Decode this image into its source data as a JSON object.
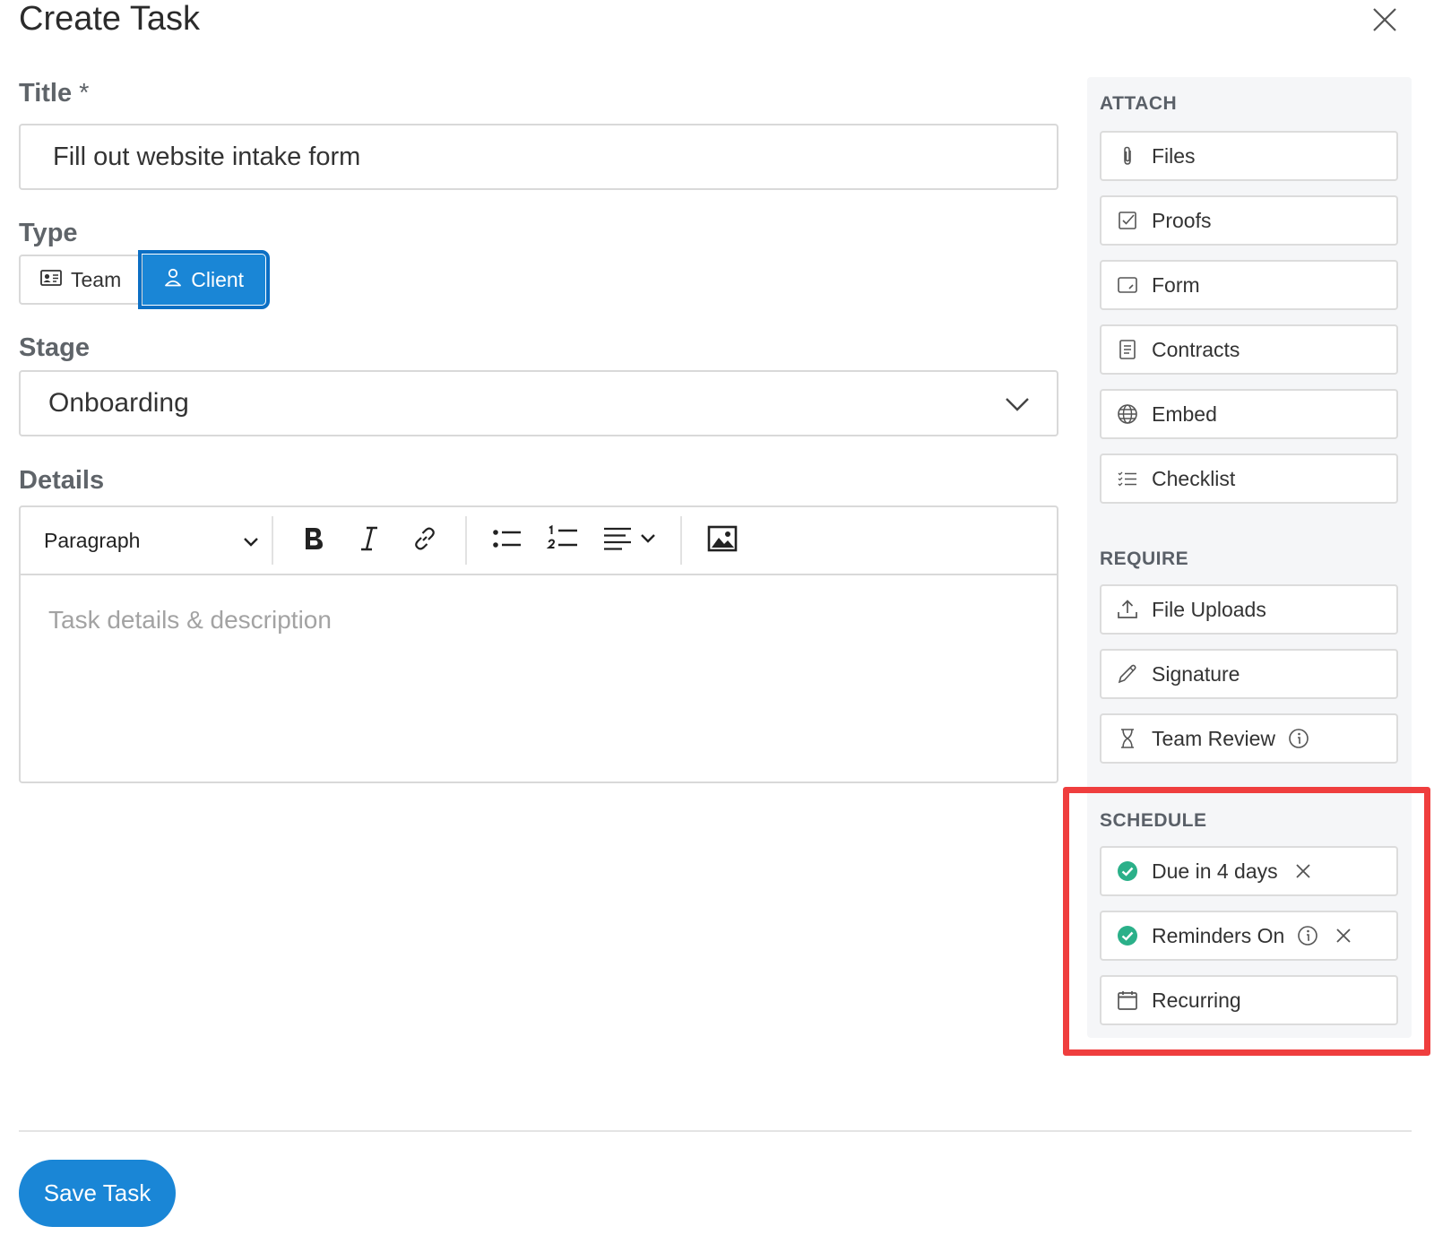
{
  "modal": {
    "title": "Create Task"
  },
  "title_field": {
    "label": "Title",
    "required_mark": "*",
    "value": "Fill out website intake form"
  },
  "type_field": {
    "label": "Type",
    "options": [
      {
        "label": "Team",
        "icon": "id-card-icon"
      },
      {
        "label": "Client",
        "icon": "person-icon",
        "selected": true
      }
    ]
  },
  "stage_field": {
    "label": "Stage",
    "value": "Onboarding"
  },
  "details_field": {
    "label": "Details",
    "toolbar": {
      "block_format": "Paragraph"
    },
    "placeholder": "Task details & description"
  },
  "attach": {
    "heading": "ATTACH",
    "items": [
      {
        "label": "Files",
        "icon": "paperclip-icon"
      },
      {
        "label": "Proofs",
        "icon": "check-square-icon"
      },
      {
        "label": "Form",
        "icon": "form-icon"
      },
      {
        "label": "Contracts",
        "icon": "document-icon"
      },
      {
        "label": "Embed",
        "icon": "globe-icon"
      },
      {
        "label": "Checklist",
        "icon": "checklist-icon"
      }
    ]
  },
  "require": {
    "heading": "REQUIRE",
    "items": [
      {
        "label": "File Uploads",
        "icon": "upload-icon"
      },
      {
        "label": "Signature",
        "icon": "pen-icon"
      },
      {
        "label": "Team Review",
        "icon": "hourglass-icon"
      }
    ]
  },
  "schedule": {
    "heading": "SCHEDULE",
    "items": [
      {
        "label": "Due in 4 days",
        "icon": "check-circle-icon",
        "active": true
      },
      {
        "label": "Reminders On",
        "icon": "check-circle-icon",
        "active": true
      },
      {
        "label": "Recurring",
        "icon": "calendar-icon"
      }
    ]
  },
  "footer": {
    "save_label": "Save Task"
  },
  "colors": {
    "primary": "#1a86d6",
    "success": "#2bb089",
    "highlight": "#ef3e3e"
  }
}
